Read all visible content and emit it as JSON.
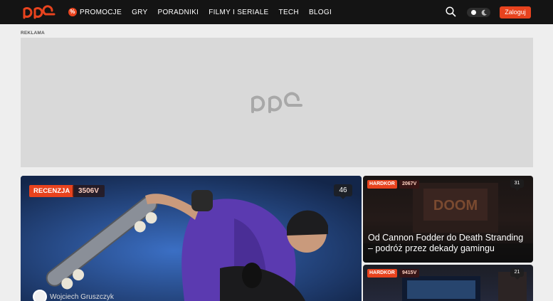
{
  "header": {
    "brand": "ppe",
    "nav_items": [
      "PROMOCJE",
      "GRY",
      "PORADNIKI",
      "FILMY I SERIALE",
      "TECH",
      "BLOGI"
    ],
    "promo_icon_symbol": "%",
    "login_label": "Zaloguj",
    "icons": {
      "search": "search-icon",
      "theme": "moon-icon"
    }
  },
  "ad": {
    "label": "REKLAMA",
    "placeholder_brand": "ppe"
  },
  "featured": {
    "category": "RECENZJA",
    "score": "3506V",
    "comments": "46",
    "author": "Wojciech Gruszczyk"
  },
  "side_articles": [
    {
      "category": "HARDKOR",
      "score": "2067V",
      "comments": "31",
      "title": "Od Cannon Fodder do Death Stranding – podróż przez dekady gamingu"
    },
    {
      "category": "HARDKOR",
      "score": "9415V",
      "comments": "21",
      "title": ""
    }
  ],
  "colors": {
    "accent": "#e8431e",
    "topbar": "#141414",
    "page_bg": "#eeeeee",
    "ad_bg": "#d9d9d9"
  }
}
